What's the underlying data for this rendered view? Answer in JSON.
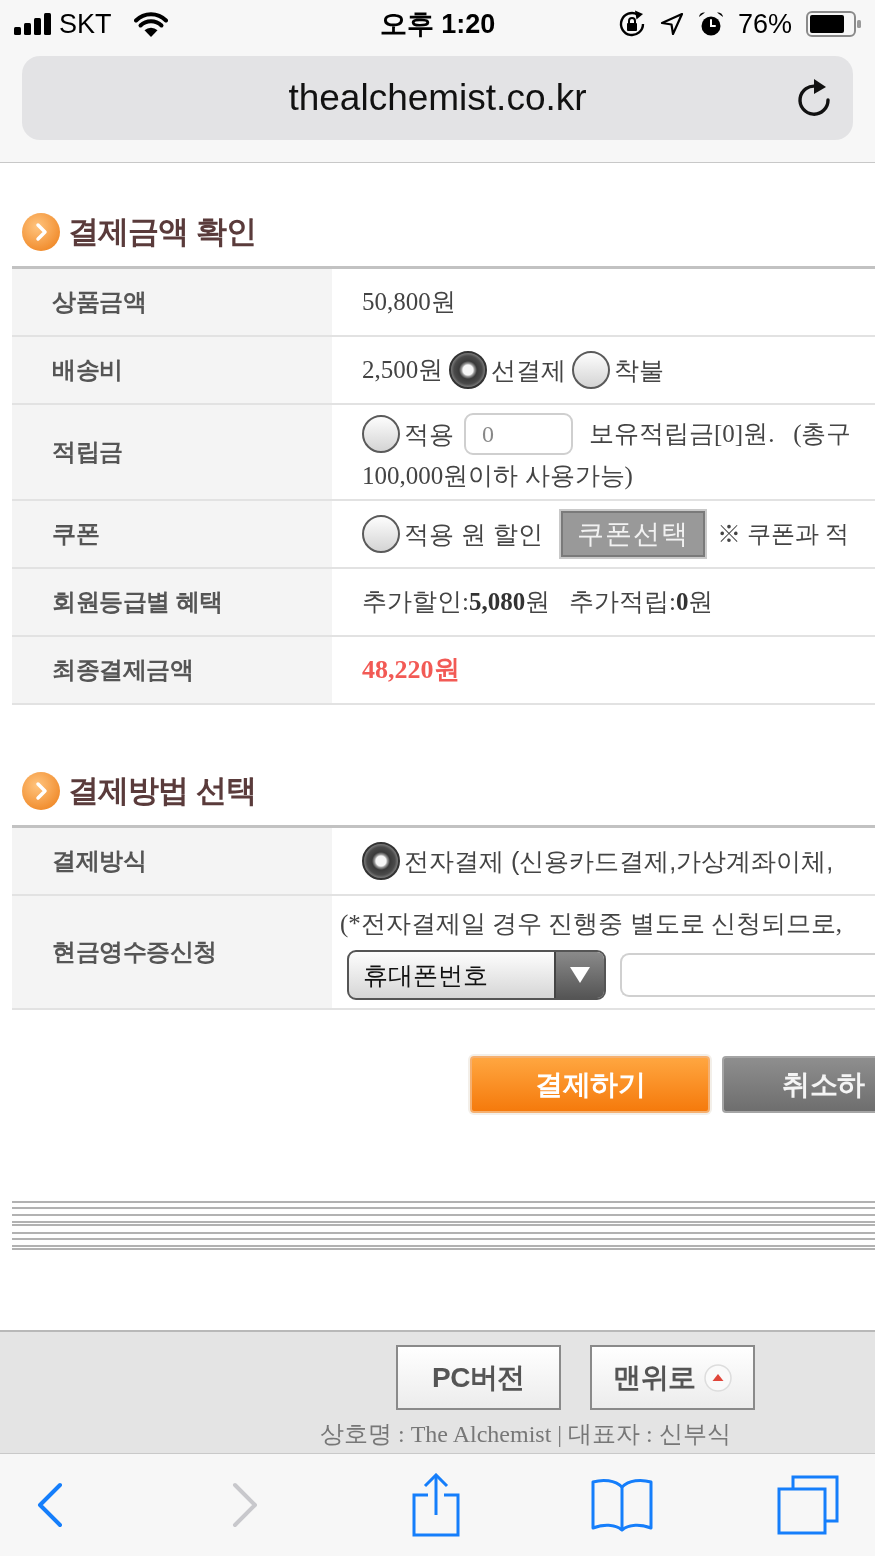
{
  "status_bar": {
    "carrier": "SKT",
    "time": "오후 1:20",
    "battery": "76%"
  },
  "address_bar": {
    "url": "thealchemist.co.kr"
  },
  "sections": [
    {
      "title": "결제금액 확인",
      "rows": [
        {
          "label": "상품금액",
          "lines": [
            [
              {
                "kind": "text",
                "text": "50,800원"
              }
            ]
          ]
        },
        {
          "label": "배송비",
          "lines": [
            [
              {
                "kind": "text",
                "text": "2,500원"
              },
              {
                "kind": "radio",
                "label": "선결제",
                "selected": true
              },
              {
                "kind": "radio",
                "label": "착불",
                "selected": false
              }
            ]
          ]
        },
        {
          "label": "적립금",
          "lines": [
            [
              {
                "kind": "option",
                "label": "적용",
                "checked": false
              },
              {
                "kind": "input",
                "value": "0"
              },
              {
                "kind": "text",
                "text": "보유적립금[0]원.   (총구"
              }
            ],
            [
              {
                "kind": "text",
                "text": "100,000원이하 사용가능)"
              }
            ]
          ]
        },
        {
          "label": "쿠폰",
          "lines": [
            [
              {
                "kind": "option",
                "label": "적용 원 할인",
                "checked": false
              },
              {
                "kind": "button",
                "label": "쿠폰선택"
              },
              {
                "kind": "note",
                "text": "※ 쿠폰과 적"
              }
            ]
          ]
        },
        {
          "label": "회원등급별 혜택",
          "lines": [
            [
              {
                "kind": "text",
                "text": "추가할인:**5,080**원   추가적립:**0**원"
              }
            ]
          ]
        },
        {
          "label": "최종결제금액",
          "lines": [
            [
              {
                "kind": "total",
                "text": "48,220원"
              }
            ]
          ]
        }
      ]
    },
    {
      "title": "결제방법 선택",
      "rows": [
        {
          "label": "결제방식",
          "lines": [
            [
              {
                "kind": "radio",
                "label": "전자결제 (신용카드결제,가상계좌이체,",
                "selected": true
              }
            ]
          ]
        },
        {
          "label": "현금영수증신청",
          "lines": [
            [
              {
                "kind": "hint",
                "text": "(*전자결제일 경우 진행중 별도로 신청되므로,"
              }
            ],
            [
              {
                "kind": "select",
                "value": "휴대폰번호"
              },
              {
                "kind": "input"
              }
            ]
          ]
        }
      ]
    }
  ],
  "actions": [
    {
      "kind": "primary",
      "label": "결제하기"
    },
    {
      "kind": "secondary",
      "label": "취소하"
    }
  ],
  "footer": {
    "buttons": [
      {
        "kind": "pc_version",
        "label": "PC버전"
      },
      {
        "kind": "scroll_top",
        "label": "맨위로"
      }
    ],
    "info": "상호명 : The Alchemist | 대표자 : 신부식"
  },
  "toolbar": [
    {
      "kind": "back",
      "disabled": false
    },
    {
      "kind": "forward",
      "disabled": true
    },
    {
      "kind": "share",
      "disabled": false
    },
    {
      "kind": "bookmarks",
      "disabled": false
    },
    {
      "kind": "tabs",
      "disabled": false
    }
  ]
}
